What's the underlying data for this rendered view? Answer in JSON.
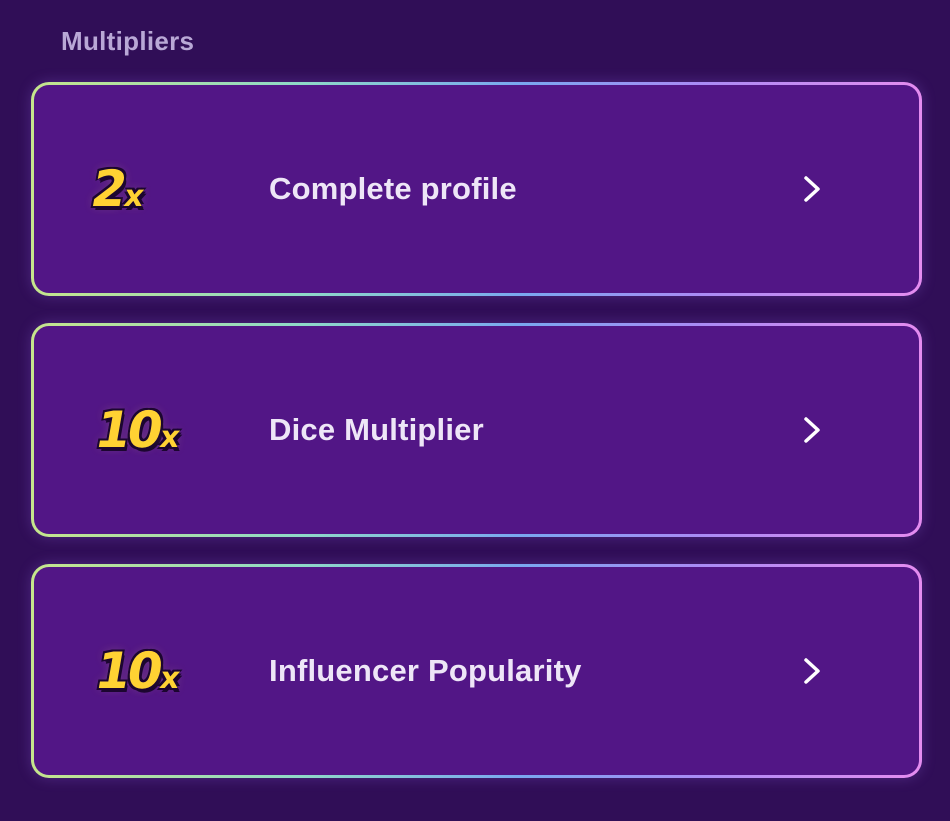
{
  "section": {
    "title": "Multipliers"
  },
  "items": [
    {
      "multiplier_value": "2",
      "multiplier_suffix": "x",
      "label": "Complete profile",
      "icon": "chevron-right-icon"
    },
    {
      "multiplier_value": "10",
      "multiplier_suffix": "x",
      "label": "Dice Multiplier",
      "icon": "chevron-right-icon"
    },
    {
      "multiplier_value": "10",
      "multiplier_suffix": "x",
      "label": "Influencer Popularity",
      "icon": "chevron-right-icon"
    }
  ],
  "colors": {
    "background": "#300e57",
    "card": "#521686",
    "multiplier": "#ffd233",
    "text": "#eee6f7",
    "section_title": "#b9a8d6"
  }
}
